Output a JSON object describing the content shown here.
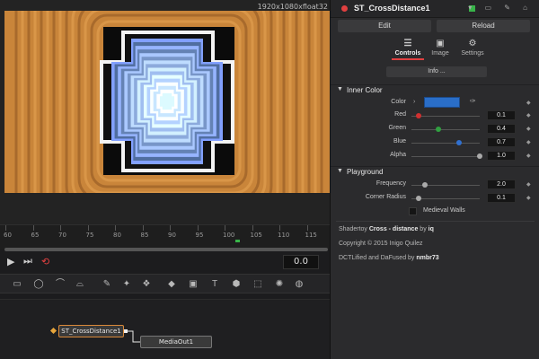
{
  "viewer": {
    "resolution": "1920x1080xfloat32"
  },
  "timeline": {
    "ticks": [
      "60",
      "65",
      "70",
      "75",
      "80",
      "85",
      "90",
      "95",
      "100",
      "105",
      "110",
      "115"
    ],
    "current_time": "0.0"
  },
  "nodes": {
    "source": "ST_CrossDistance1",
    "output": "MediaOut1"
  },
  "inspector": {
    "title": "ST_CrossDistance1",
    "edit_label": "Edit",
    "reload_label": "Reload",
    "tabs": [
      {
        "label": "Controls",
        "icon": "sliders-icon"
      },
      {
        "label": "Image",
        "icon": "image-icon"
      },
      {
        "label": "Settings",
        "icon": "gear-icon"
      }
    ],
    "info_label": "Info ...",
    "inner_color": {
      "section_title": "Inner Color",
      "color_label": "Color",
      "swatch_color": "#2a6ec8",
      "params": [
        {
          "label": "Red",
          "value": "0.1",
          "level": 0.1,
          "knob_color": "#d03030"
        },
        {
          "label": "Green",
          "value": "0.4",
          "level": 0.4,
          "knob_color": "#30a040"
        },
        {
          "label": "Blue",
          "value": "0.7",
          "level": 0.7,
          "knob_color": "#3070d0"
        },
        {
          "label": "Alpha",
          "value": "1.0",
          "level": 1.0,
          "knob_color": "#aaaaaa"
        }
      ]
    },
    "playground": {
      "section_title": "Playground",
      "params": [
        {
          "label": "Frequency",
          "value": "2.0",
          "level": 0.2,
          "knob_color": "#aaaaaa"
        },
        {
          "label": "Corner Radius",
          "value": "0.1",
          "level": 0.1,
          "knob_color": "#aaaaaa"
        }
      ],
      "checkbox_label": "Medieval Walls"
    },
    "credits": {
      "line1_prefix": "Shadertoy",
      "line1_name": "Cross - distance",
      "line1_by": "by",
      "line1_author": "iq",
      "line2": "Copyright © 2015 Inigo Quilez",
      "line3_prefix": "DCTLified and DaFused by",
      "line3_author": "nmbr73"
    }
  },
  "colors": {
    "accent_red": "#e04040",
    "node_orange": "#d9893a",
    "keyframe_green": "#38b449"
  }
}
